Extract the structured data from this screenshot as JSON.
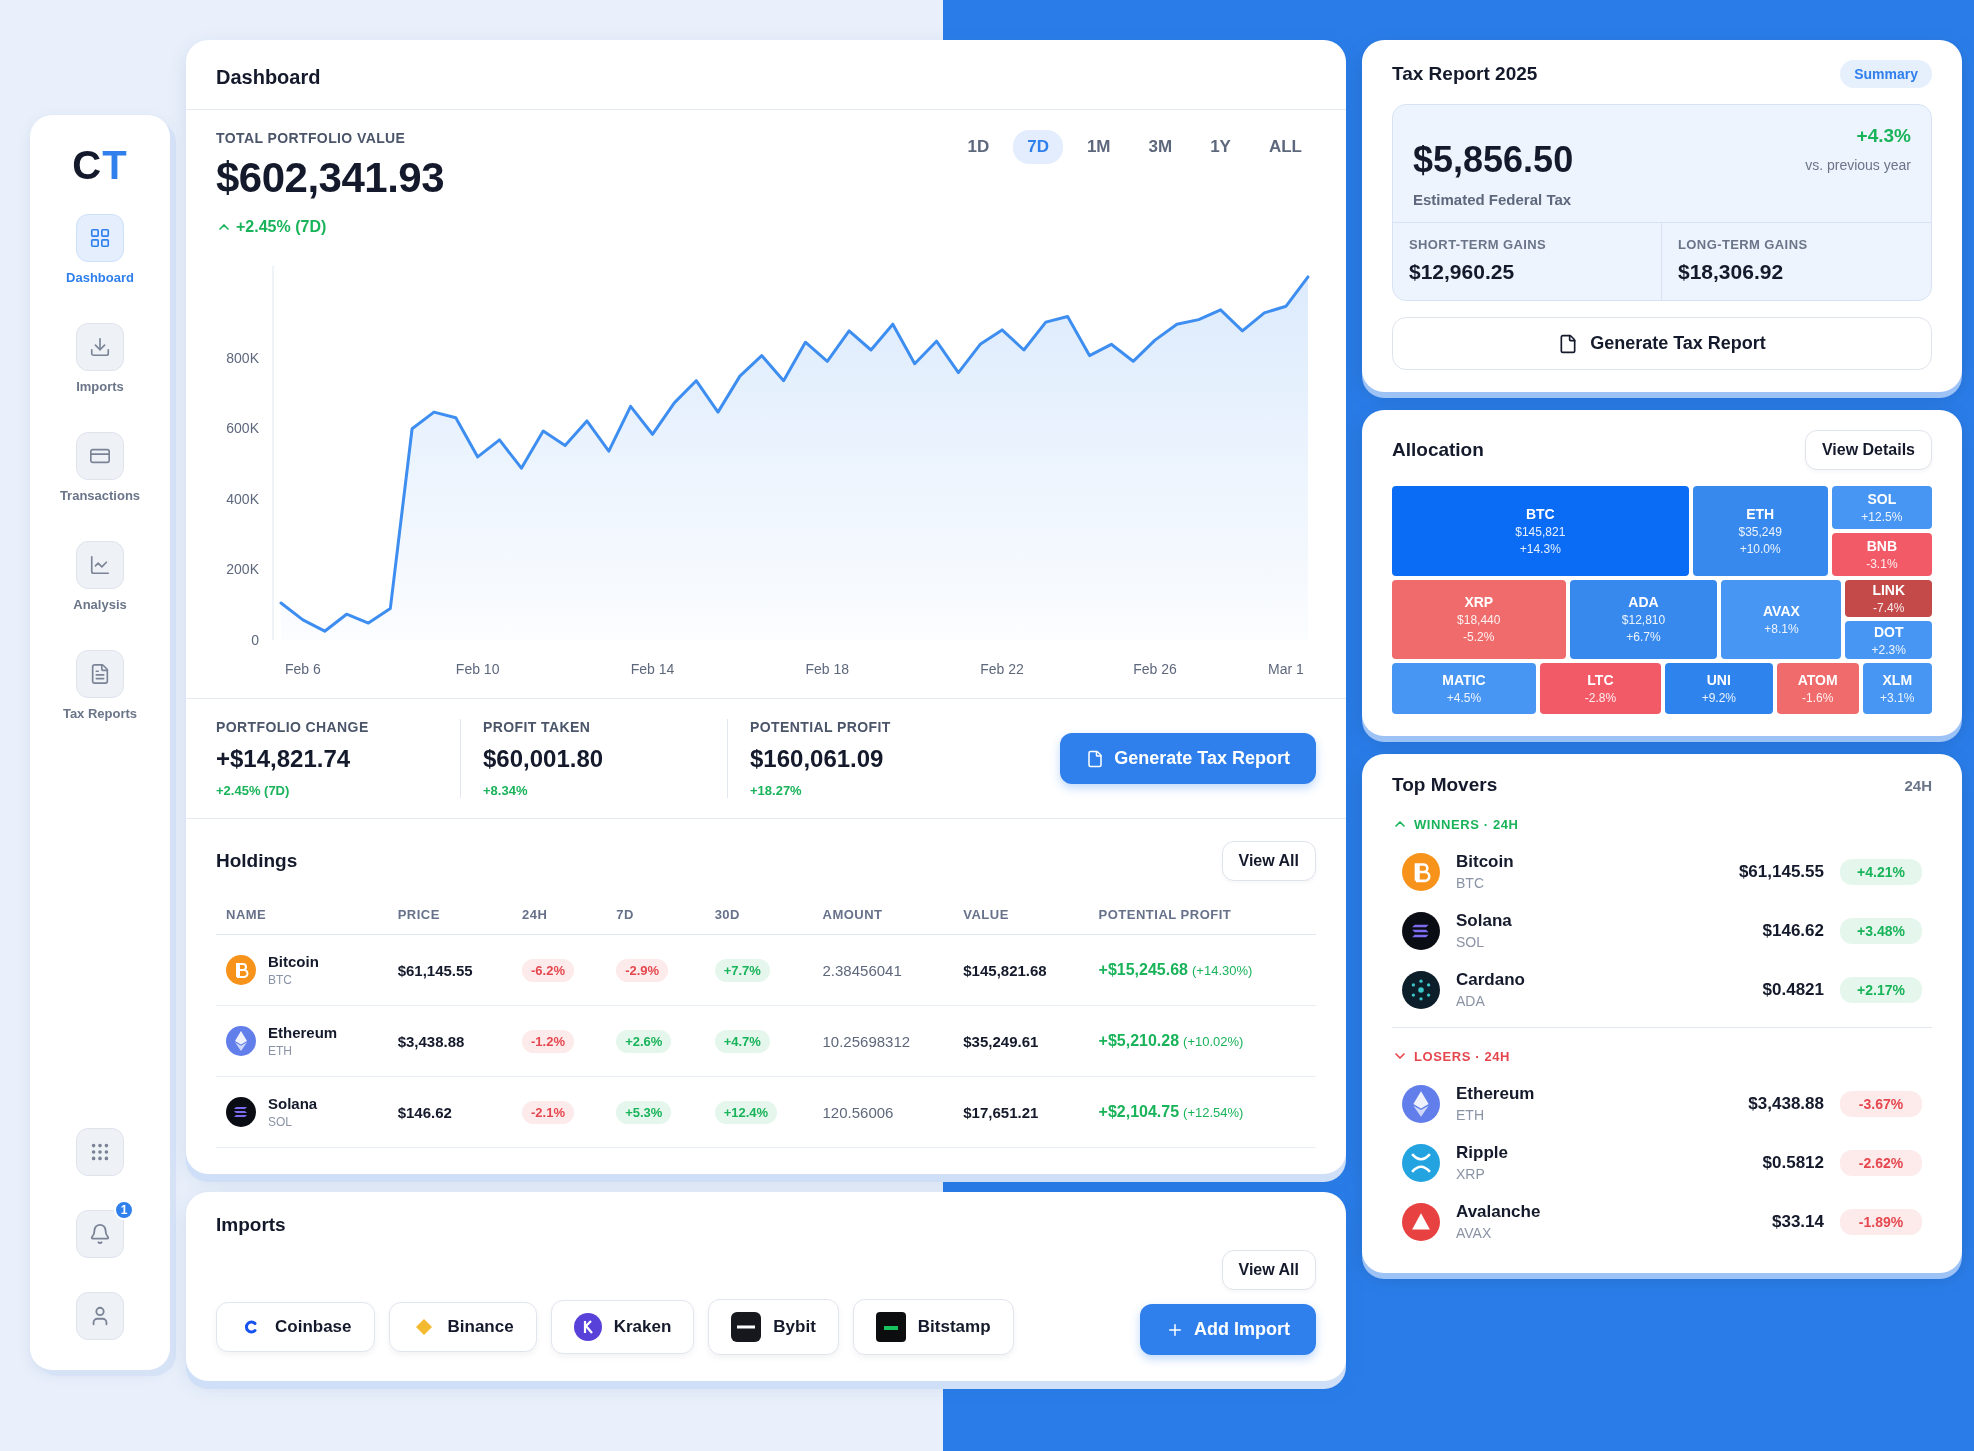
{
  "sidebar": {
    "logo": {
      "first": "C",
      "second": "T"
    },
    "items": [
      {
        "label": "Dashboard",
        "kind": "grid",
        "selected": true
      },
      {
        "label": "Imports",
        "kind": "download",
        "selected": false
      },
      {
        "label": "Transactions",
        "kind": "card",
        "selected": false
      },
      {
        "label": "Analysis",
        "kind": "chart",
        "selected": false
      },
      {
        "label": "Tax Reports",
        "kind": "report",
        "selected": false
      }
    ],
    "bottom": [
      {
        "kind": "apps"
      },
      {
        "kind": "bell",
        "badge": "1"
      },
      {
        "kind": "user"
      }
    ]
  },
  "dashboard": {
    "title": "Dashboard",
    "portfolio_label": "TOTAL PORTFOLIO VALUE",
    "portfolio_value": "$602,341.93",
    "portfolio_change": "+2.45% (7D)",
    "ranges": [
      {
        "label": "1D",
        "selected": false
      },
      {
        "label": "7D",
        "selected": true
      },
      {
        "label": "1M",
        "selected": false
      },
      {
        "label": "3M",
        "selected": false
      },
      {
        "label": "1Y",
        "selected": false
      },
      {
        "label": "ALL",
        "selected": false
      }
    ],
    "chart_data": {
      "type": "area",
      "categories": [
        null,
        "Feb 6",
        null,
        null,
        null,
        null,
        null,
        null,
        null,
        "Feb 10",
        null,
        null,
        null,
        null,
        null,
        null,
        null,
        "Feb 14",
        null,
        null,
        null,
        null,
        null,
        null,
        null,
        "Feb 18",
        null,
        null,
        null,
        null,
        null,
        null,
        null,
        "Feb 22",
        null,
        null,
        null,
        null,
        null,
        null,
        "Feb 26",
        null,
        null,
        null,
        null,
        null,
        "Mar 1",
        null
      ],
      "series": [
        {
          "color": "#3d8ef0",
          "values": [
            105,
            57,
            25,
            73,
            48,
            89,
            599,
            646,
            630,
            519,
            567,
            487,
            592,
            551,
            621,
            535,
            662,
            583,
            672,
            735,
            646,
            748,
            806,
            735,
            844,
            790,
            876,
            822,
            895,
            783,
            847,
            758,
            838,
            879,
            822,
            901,
            917,
            806,
            838,
            790,
            850,
            895,
            908,
            936,
            876,
            927,
            946,
            1029
          ]
        }
      ],
      "ylim": [
        0,
        1060
      ],
      "yticks": [
        {
          "value": 0,
          "label": "0"
        },
        {
          "value": 200,
          "label": "200K"
        },
        {
          "value": 400,
          "label": "400K"
        },
        {
          "value": 600,
          "label": "600K"
        },
        {
          "value": 800,
          "label": "800K"
        }
      ]
    }
  },
  "stats": [
    {
      "label": "PORTFOLIO CHANGE",
      "value": "+$14,821.74",
      "change": "+2.45% (7D)"
    },
    {
      "label": "PROFIT TAKEN",
      "value": "$60,001.80",
      "change": "+8.34%"
    },
    {
      "label": "POTENTIAL PROFIT",
      "value": "$160,061.09",
      "change": "+18.27%"
    }
  ],
  "generate_button": "Generate Tax Report",
  "holdings": {
    "title": "Holdings",
    "view_all": "View All",
    "columns": [
      "NAME",
      "PRICE",
      "24H",
      "7D",
      "30D",
      "AMOUNT",
      "VALUE",
      "POTENTIAL PROFIT"
    ],
    "rows": [
      {
        "name": "Bitcoin",
        "symbol": "BTC",
        "kind": "btc",
        "price": "$61,145.55",
        "changes": [
          {
            "text": "-6.2%",
            "kind": "down"
          },
          {
            "text": "-2.9%",
            "kind": "down"
          },
          {
            "text": "+7.7%",
            "kind": "up"
          }
        ],
        "amount": "2.38456041",
        "value": "$145,821.68",
        "profit": "+$15,245.68",
        "profit_pct": "(+14.30%)"
      },
      {
        "name": "Ethereum",
        "symbol": "ETH",
        "kind": "eth",
        "price": "$3,438.88",
        "changes": [
          {
            "text": "-1.2%",
            "kind": "down"
          },
          {
            "text": "+2.6%",
            "kind": "up"
          },
          {
            "text": "+4.7%",
            "kind": "up"
          }
        ],
        "amount": "10.25698312",
        "value": "$35,249.61",
        "profit": "+$5,210.28",
        "profit_pct": "(+10.02%)"
      },
      {
        "name": "Solana",
        "symbol": "SOL",
        "kind": "sol",
        "price": "$146.62",
        "changes": [
          {
            "text": "-2.1%",
            "kind": "down"
          },
          {
            "text": "+5.3%",
            "kind": "up"
          },
          {
            "text": "+12.4%",
            "kind": "up"
          }
        ],
        "amount": "120.56006",
        "value": "$17,651.21",
        "profit": "+$2,104.75",
        "profit_pct": "(+12.54%)"
      }
    ]
  },
  "imports": {
    "title": "Imports",
    "exchanges": [
      {
        "name": "Coinbase",
        "kind": "coinbase"
      },
      {
        "name": "Binance",
        "kind": "binance"
      },
      {
        "name": "Kraken",
        "kind": "kraken"
      },
      {
        "name": "Bybit",
        "kind": "bybit"
      },
      {
        "name": "Bitstamp",
        "kind": "bitstamp"
      }
    ],
    "view_all": "View All",
    "add_button": "Add Import"
  },
  "tax_report": {
    "title": "Tax Report 2025",
    "badge": "Summary",
    "amount": "$5,856.50",
    "amount_label": "Estimated Federal Tax",
    "change": "+4.3%",
    "change_label": "vs. previous year",
    "gains": [
      {
        "label": "SHORT-TERM GAINS",
        "value": "$12,960.25"
      },
      {
        "label": "LONG-TERM GAINS",
        "value": "$18,306.92"
      }
    ],
    "button": "Generate Tax Report"
  },
  "allocation": {
    "title": "Allocation",
    "view_details": "View Details",
    "tiles": [
      {
        "symbol": "BTC",
        "value": "$145,821",
        "change": "+14.3%",
        "color": "#0a6cf5"
      },
      {
        "symbol": "ETH",
        "value": "$35,249",
        "change": "+10.0%",
        "color": "#3889ee"
      },
      {
        "symbol": "SOL",
        "change": "+12.5%",
        "color": "#4896f3"
      },
      {
        "symbol": "BNB",
        "change": "-3.1%",
        "color": "#f25a68"
      },
      {
        "symbol": "XRP",
        "value": "$18,440",
        "change": "-5.2%",
        "color": "#f06b6b"
      },
      {
        "symbol": "ADA",
        "value": "$12,810",
        "change": "+6.7%",
        "color": "#3889ee"
      },
      {
        "symbol": "AVAX",
        "change": "+8.1%",
        "color": "#4896f3"
      },
      {
        "symbol": "LINK",
        "change": "-7.4%",
        "color": "#c44a4a"
      },
      {
        "symbol": "DOT",
        "change": "+2.3%",
        "color": "#4896f3"
      },
      {
        "symbol": "MATIC",
        "change": "+4.5%",
        "color": "#4896f3"
      },
      {
        "symbol": "LTC",
        "change": "-2.8%",
        "color": "#f25a68"
      },
      {
        "symbol": "UNI",
        "change": "+9.2%",
        "color": "#2f83ec"
      },
      {
        "symbol": "ATOM",
        "change": "-1.6%",
        "color": "#f06b6b"
      },
      {
        "symbol": "XLM",
        "change": "+3.1%",
        "color": "#4896f3"
      }
    ]
  },
  "top_movers": {
    "title": "Top Movers",
    "period": "24H",
    "sections": [
      {
        "kind": "winners",
        "title": "WINNERS · 24H",
        "items": [
          {
            "name": "Bitcoin",
            "symbol": "BTC",
            "kind": "btc",
            "price": "$61,145.55",
            "change": "+4.21%"
          },
          {
            "name": "Solana",
            "symbol": "SOL",
            "kind": "sol",
            "price": "$146.62",
            "change": "+3.48%"
          },
          {
            "name": "Cardano",
            "symbol": "ADA",
            "kind": "ada",
            "price": "$0.4821",
            "change": "+2.17%"
          }
        ]
      },
      {
        "kind": "losers",
        "title": "LOSERS · 24H",
        "items": [
          {
            "name": "Ethereum",
            "symbol": "ETH",
            "kind": "eth",
            "price": "$3,438.88",
            "change": "-3.67%"
          },
          {
            "name": "Ripple",
            "symbol": "XRP",
            "kind": "xrp",
            "price": "$0.5812",
            "change": "-2.62%"
          },
          {
            "name": "Avalanche",
            "symbol": "AVAX",
            "kind": "avax",
            "price": "$33.14",
            "change": "-1.89%"
          }
        ]
      }
    ]
  }
}
